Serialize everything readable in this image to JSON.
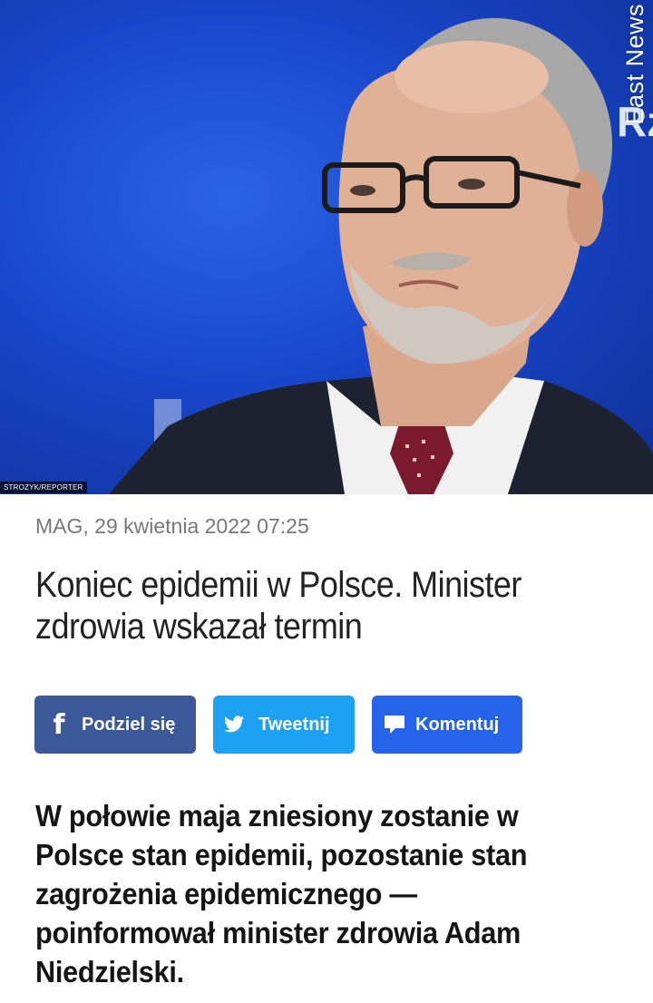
{
  "hero": {
    "photo_source": "East News",
    "photo_credit": "STROZYK/REPORTER",
    "background_color": "#1846c9"
  },
  "article": {
    "meta": "MAG, 29 kwietnia 2022 07:25",
    "headline": "Koniec epidemii w Polsce. Minister zdrowia wskazał termin",
    "lead": "W połowie maja zniesiony zostanie w Polsce stan epidemii, pozostanie stan zagrożenia epidemicznego — poinformował minister zdrowia Adam Niedzielski."
  },
  "share": {
    "facebook": {
      "label": "Podziel się",
      "icon": "facebook-icon",
      "color": "#3b5998"
    },
    "twitter": {
      "label": "Tweetnij",
      "icon": "twitter-bird-icon",
      "color": "#1da1f2"
    },
    "comment": {
      "label": "Komentuj",
      "icon": "speech-bubble-icon",
      "color": "#2563eb"
    }
  }
}
